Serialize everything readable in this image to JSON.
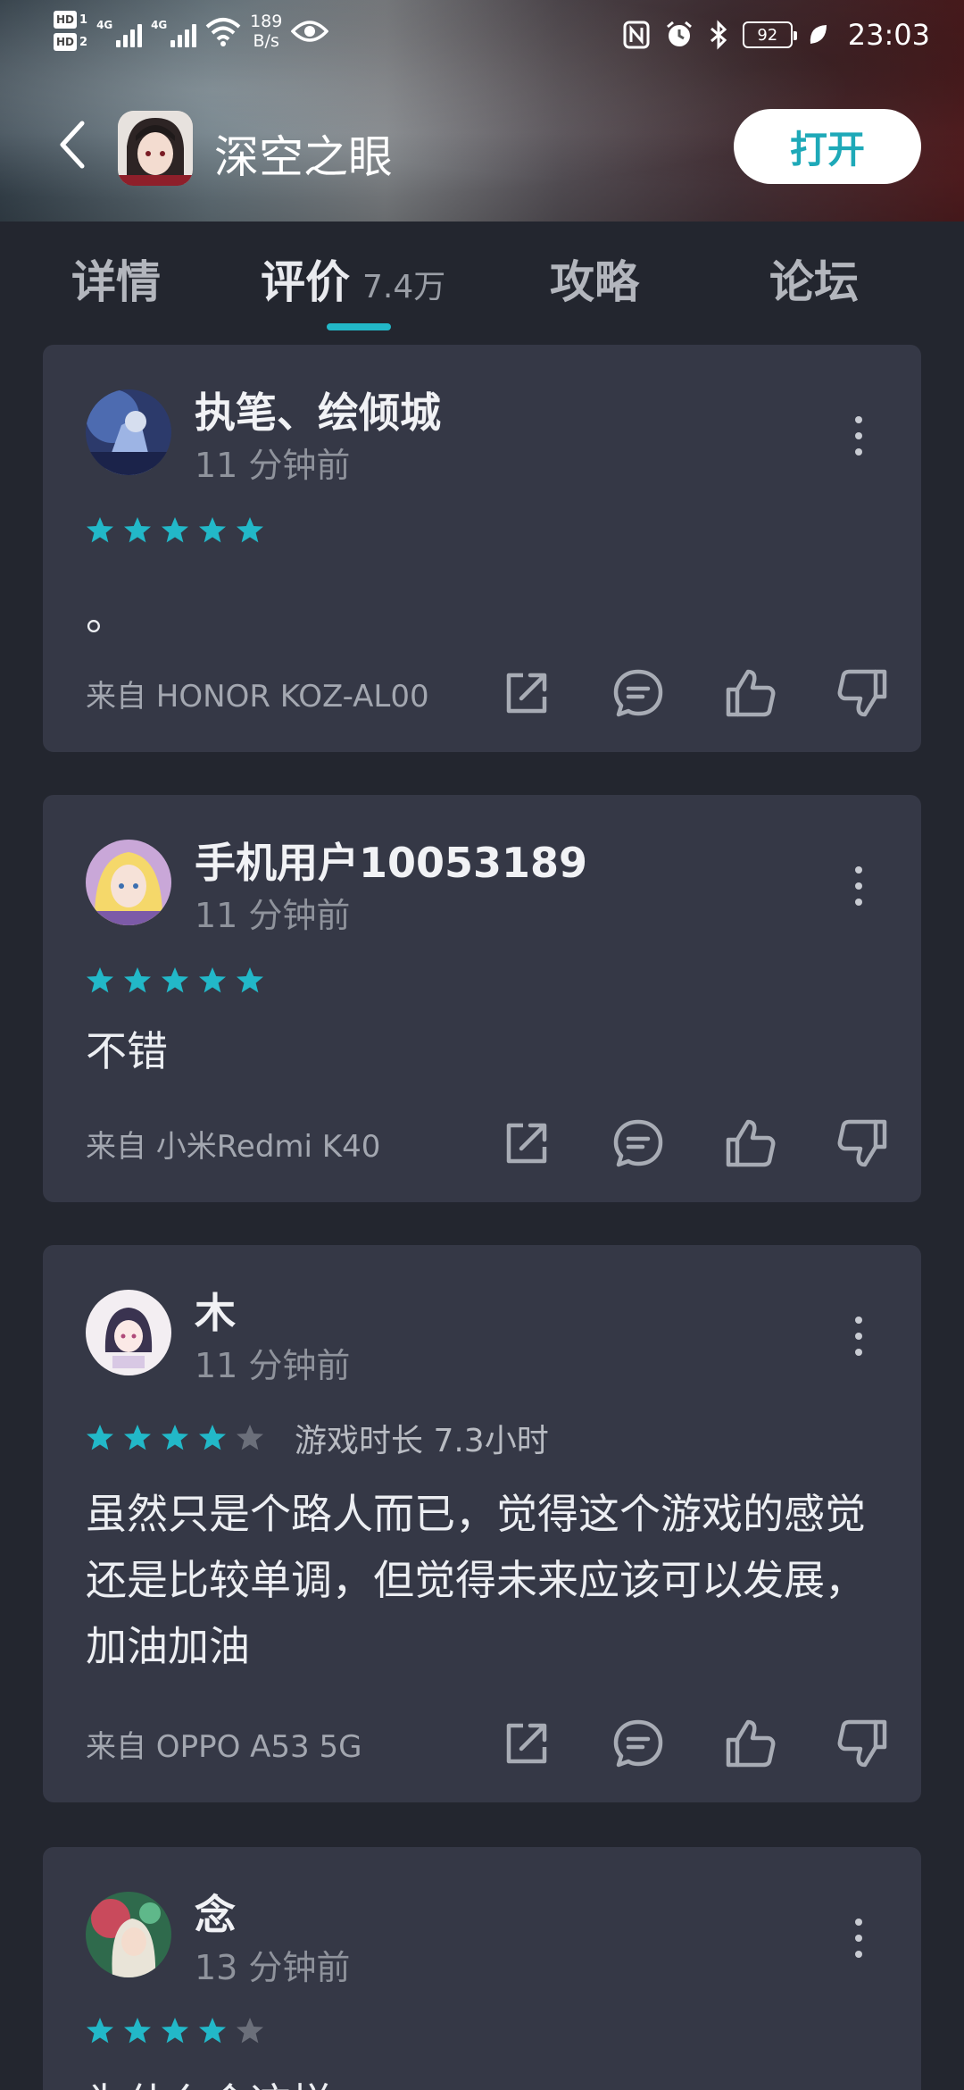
{
  "status_bar": {
    "hd1": "HD",
    "hd1_num": "1",
    "hd2": "HD",
    "hd2_num": "2",
    "sig1_label": "4G",
    "sig2_label": "4G",
    "net_speed_value": "189",
    "net_speed_unit": "B/s",
    "battery": "92",
    "time": "23:03"
  },
  "header": {
    "app_title": "深空之眼",
    "open_button": "打开"
  },
  "tabs": [
    {
      "label": "详情"
    },
    {
      "label": "评价",
      "count": "7.4万"
    },
    {
      "label": "攻略"
    },
    {
      "label": "论坛"
    }
  ],
  "reviews": [
    {
      "user": "执笔、绘倾城",
      "time": "11 分钟前",
      "rating": 5,
      "playtime": "",
      "text": "。",
      "source": "来自 HONOR KOZ-AL00"
    },
    {
      "user": "手机用户10053189",
      "time": "11 分钟前",
      "rating": 5,
      "playtime": "",
      "text": "不错",
      "source": "来自 小米Redmi K40"
    },
    {
      "user": "木",
      "time": "11 分钟前",
      "rating": 4,
      "playtime": "游戏时长 7.3小时",
      "text": "虽然只是个路人而已，觉得这个游戏的感觉还是比较单调，但觉得未来应该可以发展，加油加油",
      "source": "来自 OPPO A53 5G"
    },
    {
      "user": "念",
      "time": "13 分钟前",
      "rating": 4,
      "playtime": "",
      "text": "为什么会这样",
      "source": ""
    }
  ],
  "colors": {
    "accent": "#22b8c8",
    "star_on": "#22b8c8",
    "star_off": "#6b6f7a",
    "card_bg": "#353846",
    "page_bg": "#23262f"
  },
  "icons": [
    "back-icon",
    "share-icon",
    "comment-icon",
    "thumb-up-icon",
    "thumb-down-icon",
    "more-icon",
    "star-icon"
  ]
}
